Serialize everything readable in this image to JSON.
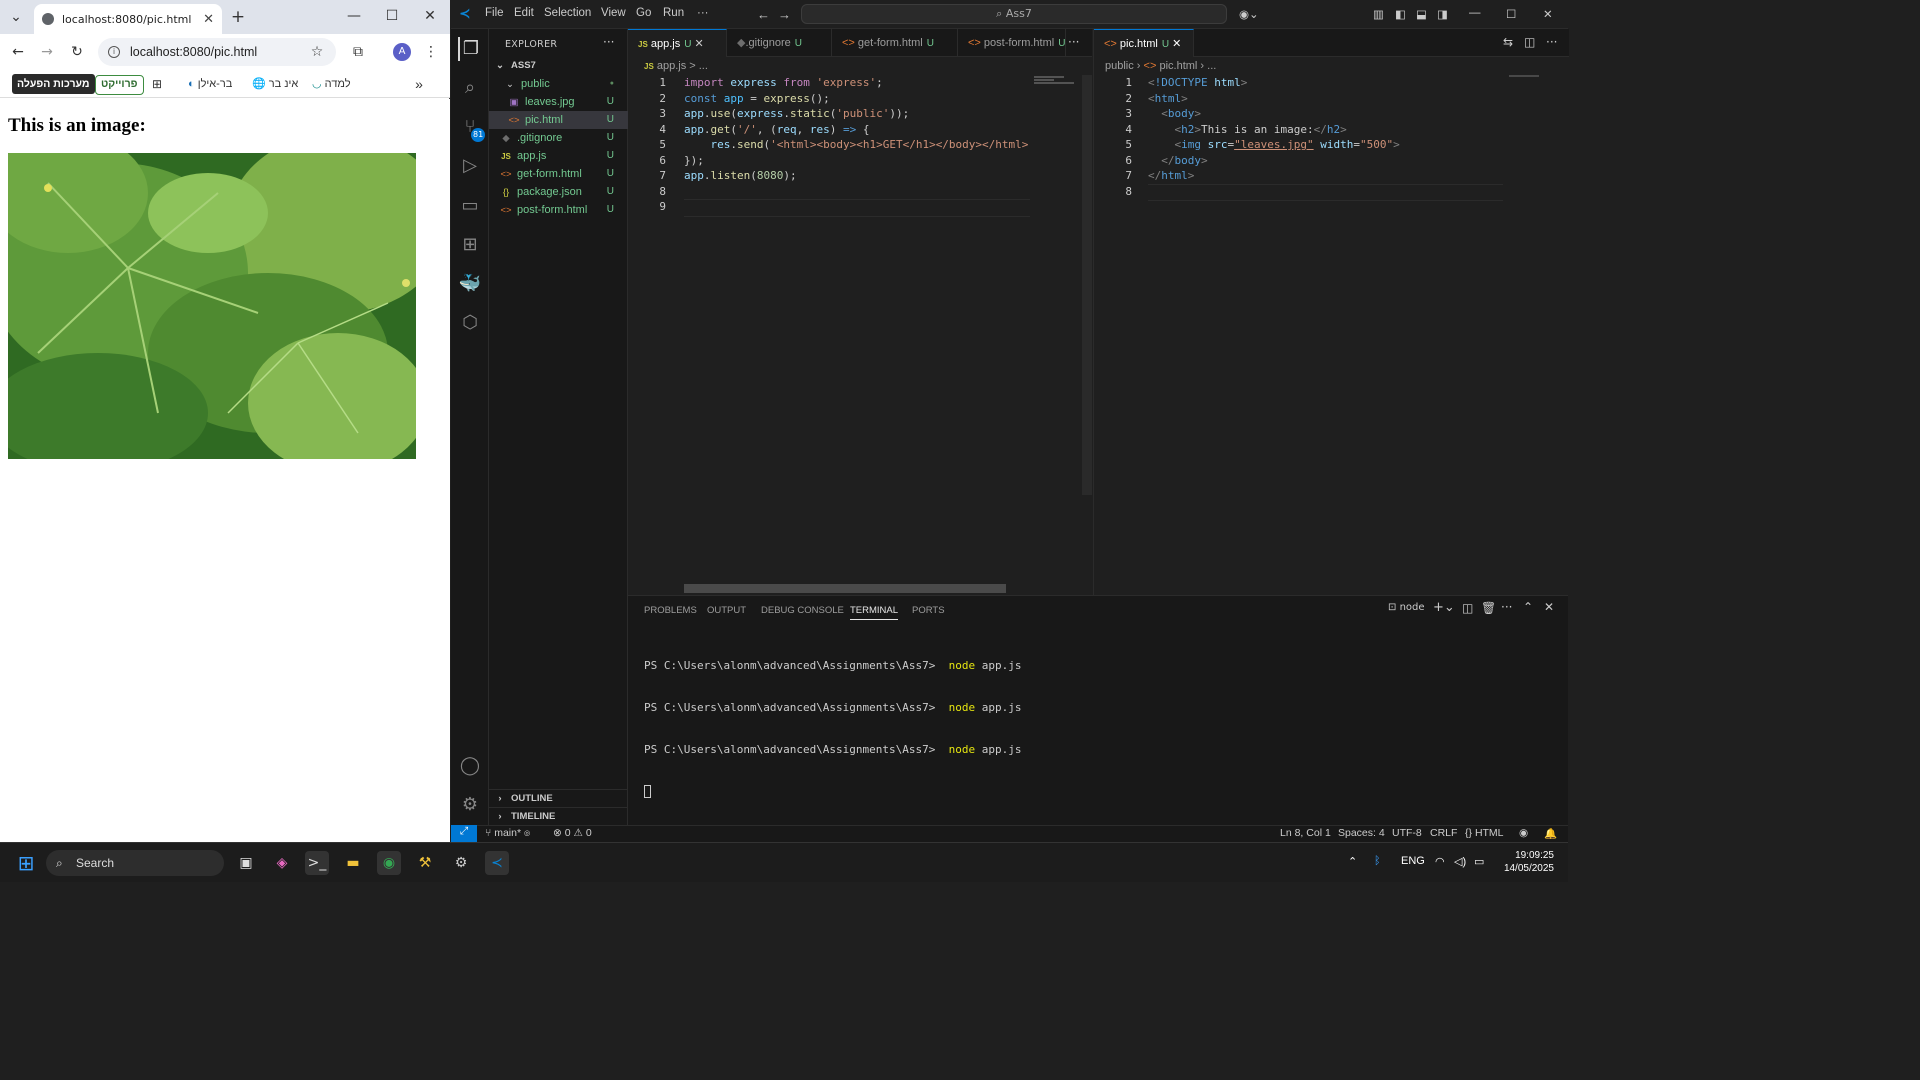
{
  "browser": {
    "tab_title": "localhost:8080/pic.html",
    "url": "localhost:8080/pic.html",
    "profile_initial": "A",
    "bookmarks": [
      "מערכות הפעלה",
      "פרוייקט",
      "בר-אילן",
      "אינ בר",
      "למדה"
    ],
    "page_heading": "This is an image:"
  },
  "vscode": {
    "menu": [
      "File",
      "Edit",
      "Selection",
      "View",
      "Go",
      "Run",
      "···"
    ],
    "search_text": "Ass7",
    "explorer_title": "EXPLORER",
    "root": "ASS7",
    "tree": [
      {
        "name": "public",
        "type": "folder",
        "status": "●"
      },
      {
        "name": "leaves.jpg",
        "type": "image",
        "status": "U"
      },
      {
        "name": "pic.html",
        "type": "html",
        "status": "U"
      },
      {
        "name": ".gitignore",
        "type": "git",
        "status": "U"
      },
      {
        "name": "app.js",
        "type": "js",
        "status": "U"
      },
      {
        "name": "get-form.html",
        "type": "html",
        "status": "U"
      },
      {
        "name": "package.json",
        "type": "json",
        "status": "U"
      },
      {
        "name": "post-form.html",
        "type": "html",
        "status": "U"
      }
    ],
    "outline": "OUTLINE",
    "timeline": "TIMELINE",
    "source_control_badge": "81",
    "editor1": {
      "tabs": [
        {
          "label": "app.js",
          "status": "U"
        },
        {
          "label": ".gitignore",
          "status": "U"
        },
        {
          "label": "get-form.html",
          "status": "U"
        },
        {
          "label": "post-form.html",
          "status": "U"
        }
      ],
      "breadcrumb": "app.js > ..."
    },
    "editor2": {
      "tab": {
        "label": "pic.html",
        "status": "U"
      },
      "breadcrumb_1": "public",
      "breadcrumb_2": "pic.html",
      "breadcrumb_3": "..."
    },
    "panel_tabs": [
      "PROBLEMS",
      "OUTPUT",
      "DEBUG CONSOLE",
      "TERMINAL",
      "PORTS"
    ],
    "terminal_label": "node",
    "terminal_prompt": "PS C:\\Users\\alonm\\advanced\\Assignments\\Ass7>",
    "terminal_cmd": "node",
    "terminal_arg": "app.js",
    "status": {
      "branch": "main*",
      "errors": "0",
      "warnings": "0",
      "position": "Ln 8, Col 1",
      "spaces": "Spaces: 4",
      "encoding": "UTF-8",
      "eol": "CRLF",
      "language": "HTML"
    }
  },
  "taskbar": {
    "search_label": "Search",
    "lang": "ENG",
    "time": "19:09:25",
    "date": "14/05/2025"
  },
  "colors": {
    "vscode_accent": "#0078d4",
    "untracked": "#73c991",
    "terminal_cmd": "#e5e510"
  }
}
